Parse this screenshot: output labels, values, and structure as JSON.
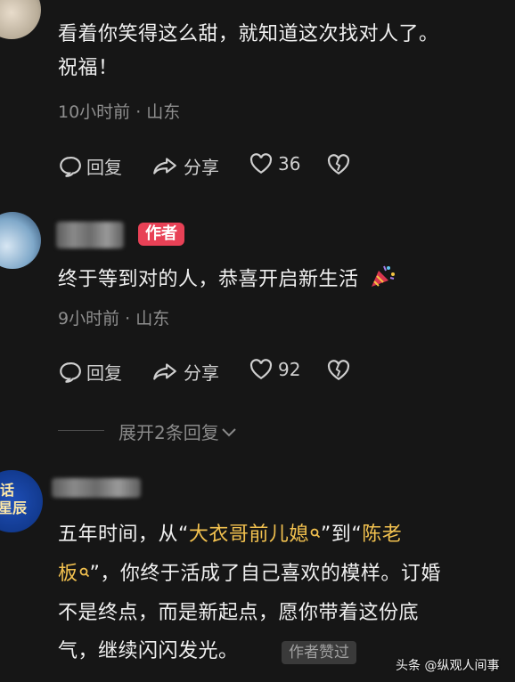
{
  "comment1": {
    "text_line1": "看着你笑得这么甜，就知道这次找对人了。",
    "text_line2": "祝福！",
    "meta": "10小时前 · 山东",
    "reply_label": "回复",
    "share_label": "分享",
    "like_count": "36"
  },
  "comment2": {
    "author_badge": "作者",
    "text": "终于等到对的人，恭喜开启新生活",
    "meta": "9小时前 · 山东",
    "reply_label": "回复",
    "share_label": "分享",
    "like_count": "92",
    "expand_label": "展开2条回复"
  },
  "comment3": {
    "avatar_text_line1": "话",
    "avatar_text_line2": "星辰",
    "text_part1": "五年时间，从“",
    "keyword1": "大衣哥前儿媳",
    "text_part2": "”到“",
    "keyword2_a": "陈老",
    "keyword2_b": "板",
    "text_part3": "”，你终于活成了自己喜欢的模样。订婚",
    "text_line3": "不是终点，而是新起点，愿你带着这份底",
    "text_line4": "气，继续闪闪发光。",
    "author_liked_badge": "作者赞过"
  },
  "watermark": "头条 @纵观人间事",
  "colors": {
    "background": "#161616",
    "author_badge": "#e84156",
    "keyword": "#f2c14f"
  }
}
